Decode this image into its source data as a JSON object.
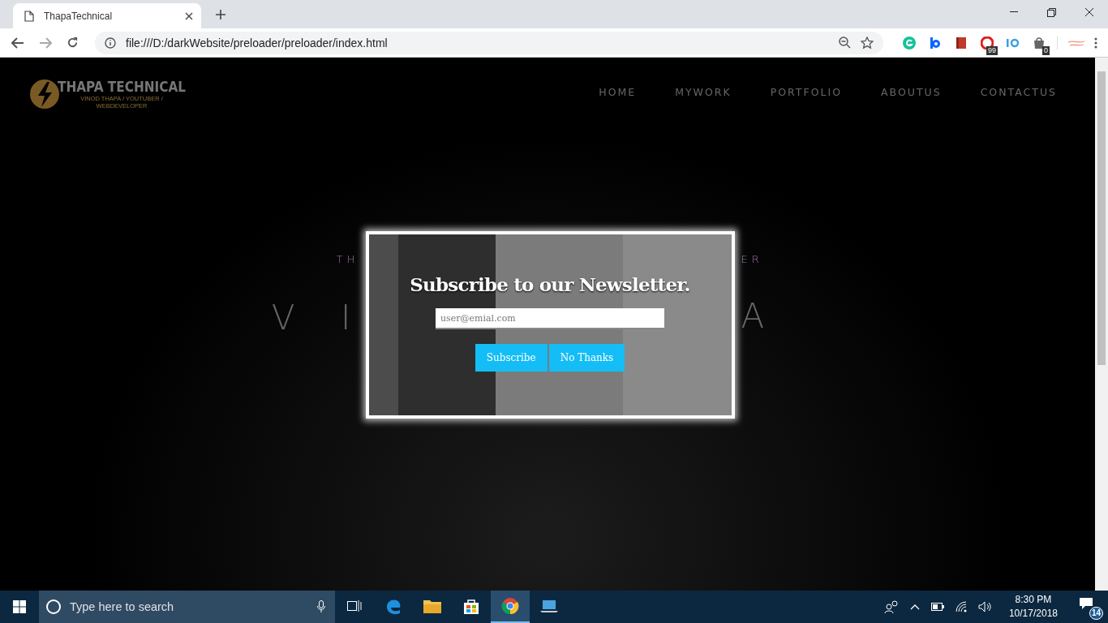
{
  "browser": {
    "tab_title": "ThapaTechnical",
    "url": "file:///D:/darkWebsite/preloader/preloader/index.html",
    "extension_badges": [
      {
        "kind": "grammar"
      },
      {
        "kind": "pin"
      },
      {
        "kind": "book"
      },
      {
        "kind": "opera",
        "badge": "99"
      },
      {
        "kind": "iq"
      },
      {
        "kind": "bag",
        "badge": "0"
      },
      {
        "kind": "sign"
      }
    ]
  },
  "site": {
    "logo_title": "THAPA TECHNICAL",
    "logo_subtitle": "VINOD THAPA / YOUTUBER / WEBDEVELOPER",
    "nav": [
      {
        "label": "HOME"
      },
      {
        "label": "MYWORK"
      },
      {
        "label": "PORTFOLIO"
      },
      {
        "label": "ABOUTUS"
      },
      {
        "label": "CONTACTUS"
      }
    ],
    "hero_fragments": {
      "tagline_left": "TH",
      "tagline_right": "ER",
      "title_left": "V  I",
      "title_right": "A"
    }
  },
  "modal": {
    "title": "Subscribe to our Newsletter.",
    "email_placeholder": "user@emial.com",
    "buttons": [
      "Subscribe",
      "No Thanks"
    ]
  },
  "taskbar": {
    "search_placeholder": "Type here to search",
    "apps": [
      {
        "kind": "taskview",
        "selected": false
      },
      {
        "kind": "edge",
        "selected": false
      },
      {
        "kind": "explorer",
        "selected": false
      },
      {
        "kind": "store",
        "selected": false
      },
      {
        "kind": "chrome",
        "selected": true
      },
      {
        "kind": "laptop",
        "selected": false
      }
    ],
    "time": "8:30 PM",
    "date": "10/17/2018",
    "notification_count": "14"
  }
}
